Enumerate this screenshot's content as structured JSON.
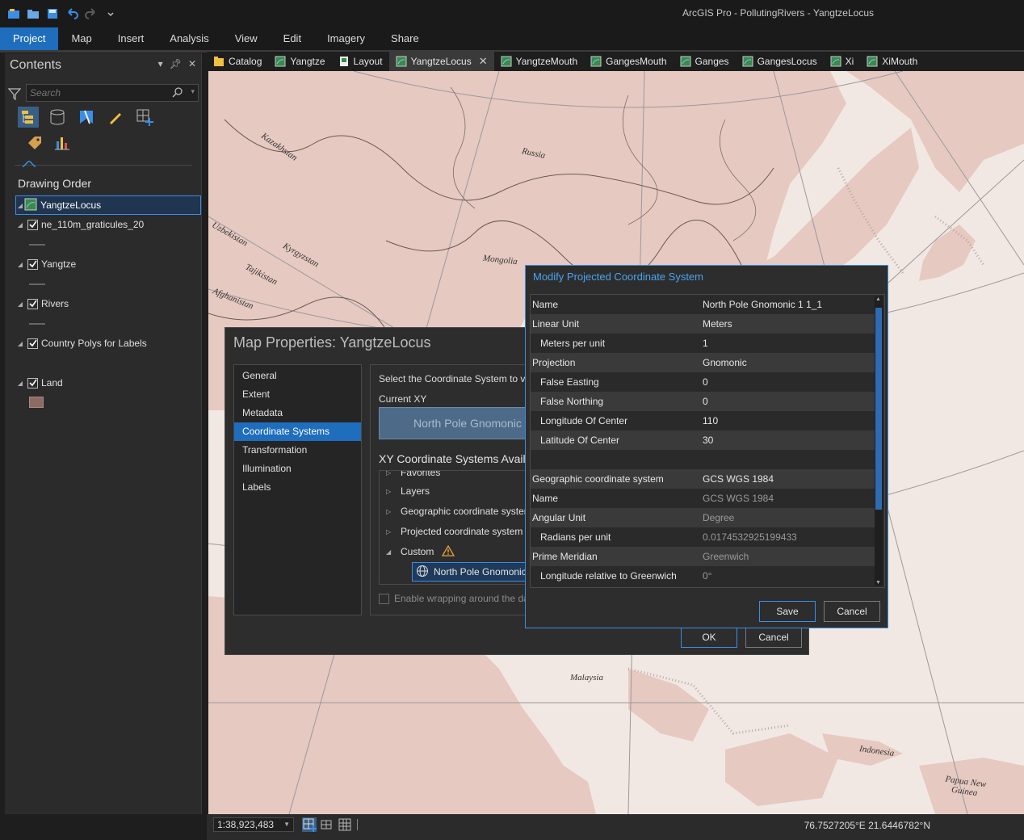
{
  "app": {
    "title": "ArcGIS Pro - PollutingRivers - YangtzeLocus"
  },
  "quick_access": [
    "project-icon",
    "open-icon",
    "save-icon",
    "undo-icon",
    "redo-icon",
    "customize-icon"
  ],
  "ribbon": {
    "tabs": [
      "Project",
      "Map",
      "Insert",
      "Analysis",
      "View",
      "Edit",
      "Imagery",
      "Share"
    ],
    "active": "Project"
  },
  "contents": {
    "title": "Contents",
    "search_placeholder": "Search",
    "drawing_order_label": "Drawing Order",
    "map_name": "YangtzeLocus",
    "layers": [
      {
        "name": "ne_110m_graticules_20",
        "checked": true
      },
      {
        "name": "Yangtze",
        "checked": true
      },
      {
        "name": "Rivers",
        "checked": true
      },
      {
        "name": "Country Polys for Labels",
        "checked": true
      },
      {
        "name": "Land",
        "checked": true
      }
    ]
  },
  "view_tabs": [
    {
      "label": "Catalog",
      "active": false
    },
    {
      "label": "Yangtze",
      "active": false
    },
    {
      "label": "Layout",
      "active": false
    },
    {
      "label": "YangtzeLocus",
      "active": true
    },
    {
      "label": "YangtzeMouth",
      "active": false
    },
    {
      "label": "GangesMouth",
      "active": false
    },
    {
      "label": "Ganges",
      "active": false
    },
    {
      "label": "GangesLocus",
      "active": false
    },
    {
      "label": "Xi",
      "active": false
    },
    {
      "label": "XiMouth",
      "active": false
    }
  ],
  "map_labels": [
    {
      "text": "Kazakhstan"
    },
    {
      "text": "Russia"
    },
    {
      "text": "Uzbekistan"
    },
    {
      "text": "Kyrgyzstan"
    },
    {
      "text": "Tajikistan"
    },
    {
      "text": "Mongolia"
    },
    {
      "text": "Afghanistan"
    },
    {
      "text": "Malaysia"
    },
    {
      "text": "Indonesia"
    },
    {
      "text": "Papua New Guinea"
    }
  ],
  "status": {
    "scale": "1:38,923,483",
    "coordinates": "76.7527205°E 21.6446782°N"
  },
  "map_properties": {
    "title": "Map Properties: YangtzeLocus",
    "nav": [
      "General",
      "Extent",
      "Metadata",
      "Coordinate Systems",
      "Transformation",
      "Illumination",
      "Labels"
    ],
    "active_nav": "Coordinate Systems",
    "instruction": "Select the Coordinate System to vi",
    "current_xy_label": "Current XY",
    "current_xy_value": "North Pole Gnomonic",
    "available_label": "XY Coordinate Systems Avail",
    "tree": [
      "Favorites",
      "Layers",
      "Geographic coordinate systen",
      "Projected coordinate system",
      "Custom"
    ],
    "selected_custom": "North Pole Gnomonic",
    "wrap_label": "Enable wrapping around the da",
    "ok_label": "OK",
    "cancel_label": "Cancel"
  },
  "modify_pcs": {
    "title": "Modify Projected Coordinate System",
    "rows": [
      {
        "key": "Name",
        "value": "North Pole Gnomonic 1 1_1",
        "indent": false,
        "dim": false
      },
      {
        "key": "Linear Unit",
        "value": "Meters",
        "indent": false,
        "dim": false
      },
      {
        "key": "Meters per unit",
        "value": "1",
        "indent": true,
        "dim": false
      },
      {
        "key": "Projection",
        "value": "Gnomonic",
        "indent": false,
        "dim": false
      },
      {
        "key": "False Easting",
        "value": "0",
        "indent": true,
        "dim": false
      },
      {
        "key": "False Northing",
        "value": "0",
        "indent": true,
        "dim": false
      },
      {
        "key": "Longitude Of Center",
        "value": "110",
        "indent": true,
        "dim": false
      },
      {
        "key": "Latitude Of Center",
        "value": "30",
        "indent": true,
        "dim": false
      },
      {
        "key": "",
        "value": "",
        "indent": false,
        "dim": false
      },
      {
        "key": "Geographic coordinate system",
        "value": "GCS WGS 1984",
        "indent": false,
        "dim": false
      },
      {
        "key": "Name",
        "value": "GCS WGS 1984",
        "indent": false,
        "dim": true
      },
      {
        "key": "Angular Unit",
        "value": "Degree",
        "indent": false,
        "dim": true
      },
      {
        "key": "Radians per unit",
        "value": "0.0174532925199433",
        "indent": true,
        "dim": true
      },
      {
        "key": "Prime Meridian",
        "value": "Greenwich",
        "indent": false,
        "dim": true
      },
      {
        "key": "Longitude relative to Greenwich",
        "value": "0°",
        "indent": true,
        "dim": true
      }
    ],
    "save_label": "Save",
    "cancel_label": "Cancel"
  },
  "colors": {
    "accent": "#1f6dbd",
    "highlight_border": "#3a8ee6",
    "dialog_title": "#4aa3f0",
    "land": "#e3c1b9",
    "sea": "#f1e8e3",
    "warning": "#e8a13a"
  }
}
